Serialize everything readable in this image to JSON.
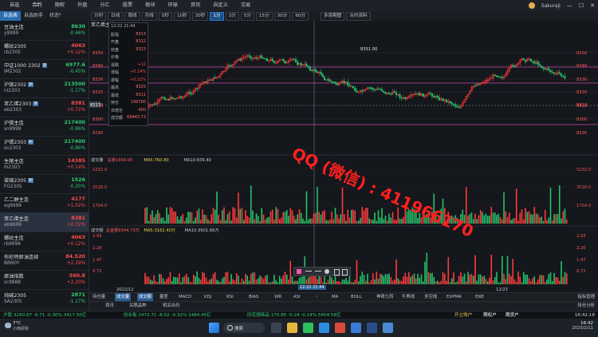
{
  "menu": [
    "自选",
    "合约",
    "期权",
    "外盘",
    "分汇",
    "股票",
    "板块",
    "环球",
    "资讯",
    "自定义",
    "交易"
  ],
  "menu_active": 1,
  "window": {
    "user": "Sakuraji",
    "min": "—",
    "max": "☐",
    "close": "✕"
  },
  "sidebar_tabs": [
    "自选表",
    "自选助手",
    "状态⁸"
  ],
  "periods": [
    "分时",
    "日线",
    "周线",
    "月线",
    "5秒",
    "10秒",
    "30秒",
    "1分",
    "3分",
    "5分",
    "15分",
    "30分",
    "60分"
  ],
  "period_active": 7,
  "toolbar_extra": [
    "多周期图",
    "合约资料"
  ],
  "watchlist": [
    {
      "name": "豆油主连",
      "code": "y9999",
      "price": "8630",
      "chg": "-0.46%",
      "dir": "dn",
      "badge": ""
    },
    {
      "name": "螺纹2305",
      "code": "rb2305",
      "price": "4063",
      "chg": "+0.12%",
      "dir": "up",
      "badge": ""
    },
    {
      "name": "中证1000 2302",
      "code": "IM2302",
      "price": "6977.6",
      "chg": "-0.45%",
      "dir": "dn",
      "badge": "期"
    },
    {
      "name": "沪银2302",
      "code": "ni2303",
      "price": "213500",
      "chg": "-1.17%",
      "dir": "dn",
      "badge": "期"
    },
    {
      "name": "苯乙烯2303",
      "code": "eb2303",
      "price": "8381",
      "chg": "+0.72%",
      "dir": "up",
      "badge": "期"
    },
    {
      "name": "沪锡主连",
      "code": "sn9999",
      "price": "217400",
      "chg": "-0.86%",
      "dir": "dn",
      "badge": ""
    },
    {
      "name": "沪锡2303",
      "code": "sn2303",
      "price": "217400",
      "chg": "-0.86%",
      "dir": "dn",
      "badge": "期"
    },
    {
      "name": "生猪主连",
      "code": "lh2303",
      "price": "14385",
      "chg": "+0.14%",
      "dir": "up",
      "badge": ""
    },
    {
      "name": "玻璃2305",
      "code": "FG2305",
      "price": "1526",
      "chg": "-0.20%",
      "dir": "dn",
      "badge": "期"
    },
    {
      "name": "乙二醇主连",
      "code": "eg9999",
      "price": "4177",
      "chg": "+1.02%",
      "dir": "up",
      "badge": ""
    },
    {
      "name": "苯乙烯主连",
      "code": "eb9999",
      "price": "8381",
      "chg": "+0.72%",
      "dir": "up",
      "badge": ""
    },
    {
      "name": "螺纹主连",
      "code": "rb9999",
      "price": "4063",
      "chg": "+0.12%",
      "dir": "up",
      "badge": ""
    },
    {
      "name": "布伦特原油连续",
      "code": "BRN0Y",
      "price": "84.520",
      "chg": "+2.29%",
      "dir": "up",
      "badge": ""
    },
    {
      "name": "原油指数",
      "code": "sc8888",
      "price": "560.8",
      "chg": "+2.20%",
      "dir": "up",
      "badge": ""
    },
    {
      "name": "纯碱2305",
      "code": "SA2305",
      "price": "2871",
      "chg": "-1.17%",
      "dir": "dn",
      "badge": ""
    }
  ],
  "selected_index": 10,
  "chart": {
    "title": "苯乙烯主连",
    "cursor_time": "12-22 21:44",
    "price_levels": [
      "8350",
      "8340",
      "8330",
      "8320",
      "8313",
      "8310",
      "8300",
      "8290"
    ],
    "peak_label": "8351.00",
    "current_price": "8313",
    "info": [
      [
        "12-22 21:44",
        ""
      ],
      [
        "股指",
        "8313"
      ],
      [
        "开盘",
        "8312"
      ],
      [
        "收盘",
        "8323"
      ],
      [
        "价格",
        ""
      ],
      [
        "涨跌",
        "+12"
      ],
      [
        "涨幅",
        "+0.14%"
      ],
      [
        "振幅",
        "+0.22%"
      ],
      [
        "最高",
        "8325"
      ],
      [
        "最低",
        "8311"
      ],
      [
        "持仓",
        "199760"
      ],
      [
        "日增仓",
        "400"
      ],
      [
        "成交额",
        "69440.73"
      ]
    ],
    "vol_header": [
      "成交量",
      "总量1669.00",
      "MA5:760.80",
      "MA10:939.40"
    ],
    "vol_levels": [
      "5292.0",
      "3528.0",
      "1764.0"
    ],
    "amt_header": [
      "成交额",
      "总金额6944.73万",
      "MA5:3162.40万",
      "MA10:3901.66万"
    ],
    "amt_levels": [
      "2.93",
      "2.20",
      "1.47",
      "0.73"
    ],
    "x_labels": [
      "2022/12",
      "12/23"
    ],
    "crosshair_time": "12-22 21:44",
    "watermark": "QQ (微信) : 411966170"
  },
  "indicator_tabs": [
    "持仓量",
    "成交量",
    "成交额",
    "量差",
    "MACD",
    "KDJ",
    "RSI",
    "BIAS",
    "WR",
    "ASI",
    "›",
    "MA",
    "BOLL",
    "神奇九转",
    "牛熊线",
    "多空线",
    "EXPMA",
    "ENE"
  ],
  "indicator_active": [
    1,
    2
  ],
  "indicator_right": "指标管理",
  "sub_tabs": [
    "资讯",
    "关联品种",
    "相关合约"
  ],
  "sub_right": "持仓分析",
  "ticker": {
    "items": [
      "沪股 3260.67 -9.71 -0.30% 3417.50亿",
      "创业板 2472.71 -8.02 -0.32% 1484.45亿",
      "同花顺商品 170.85 -0.24 -0.14% 5604.58亿"
    ],
    "right": [
      "开立账户",
      "期权户",
      "期货户"
    ],
    "time": "16:42:18"
  },
  "taskbar": {
    "weather_temp": "7°C",
    "weather_desc": "小雨即将",
    "search": "搜索",
    "clock_time": "16:42",
    "clock_date": "2023/2/11"
  }
}
